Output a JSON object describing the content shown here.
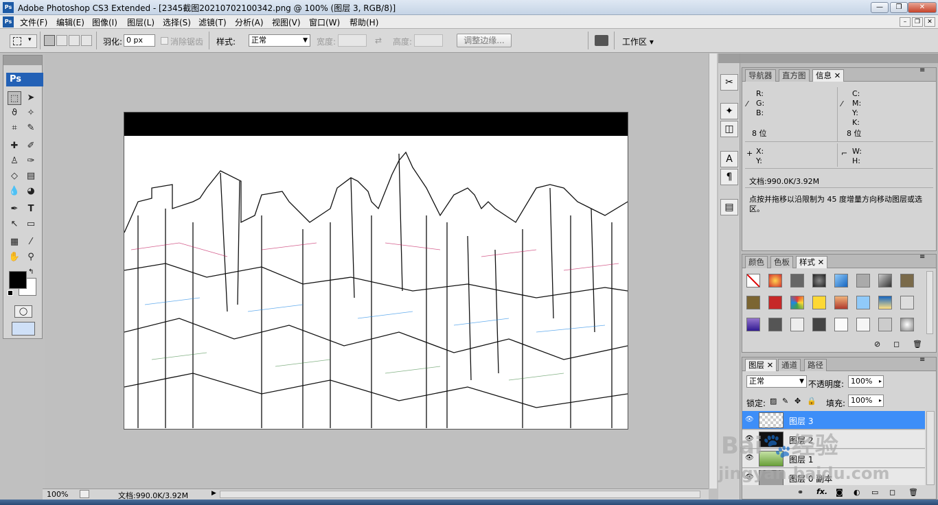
{
  "window": {
    "title": "Adobe Photoshop CS3 Extended - [2345截图20210702100342.png @ 100% (图层 3, RGB/8)]",
    "app_icon": "Ps"
  },
  "menu": {
    "items": [
      "文件(F)",
      "编辑(E)",
      "图像(I)",
      "图层(L)",
      "选择(S)",
      "滤镜(T)",
      "分析(A)",
      "视图(V)",
      "窗口(W)",
      "帮助(H)"
    ]
  },
  "options": {
    "feather_label": "羽化:",
    "feather_value": "0 px",
    "antialias_label": "消除锯齿",
    "style_label": "样式:",
    "style_value": "正常",
    "width_label": "宽度:",
    "height_label": "高度:",
    "refine_label": "调整边缘...",
    "workspace_label": "工作区"
  },
  "toolbox": {
    "ps_label": "Ps"
  },
  "status": {
    "zoom": "100%",
    "doc": "文档:990.0K/3.92M"
  },
  "info_panel": {
    "tabs": [
      "导航器",
      "直方图",
      "信息"
    ],
    "rgb": [
      "R:",
      "G:",
      "B:"
    ],
    "cmyk": [
      "C:",
      "M:",
      "Y:",
      "K:"
    ],
    "bit_left": "8 位",
    "bit_right": "8 位",
    "xy": [
      "X:",
      "Y:"
    ],
    "wh": [
      "W:",
      "H:"
    ],
    "doc": "文档:990.0K/3.92M",
    "hint": "点按并拖移以沿限制为 45 度增量方向移动图层或选区。"
  },
  "styles_panel": {
    "tabs": [
      "颜色",
      "色板",
      "样式"
    ]
  },
  "layers_panel": {
    "tabs": [
      "图层",
      "通道",
      "路径"
    ],
    "blend_mode": "正常",
    "opacity_label": "不透明度:",
    "opacity": "100%",
    "lock_label": "锁定:",
    "fill_label": "填充:",
    "fill": "100%",
    "layers": [
      "图层 3",
      "图层 2",
      "图层 1",
      "图层 0 副本"
    ]
  },
  "watermark": {
    "brand": "Bai",
    "brand_cn": "经验",
    "url": "jingyan.baidu.com"
  },
  "colors": {
    "selection": "#3d8ef8",
    "ps_blue": "#2361b6"
  }
}
